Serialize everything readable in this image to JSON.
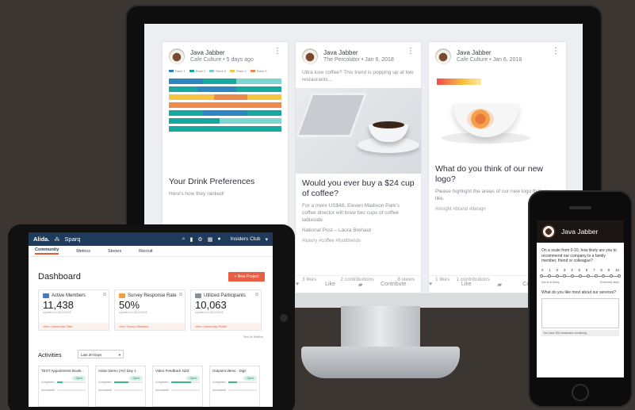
{
  "desktop": {
    "cards": [
      {
        "author": "Java Jabber",
        "meta": "Cafe Culture • 5 days ago",
        "chart_legend": [
          "Rank 1",
          "Rank 2",
          "Rank 3",
          "Rank 4",
          "Rank 5"
        ],
        "title": "Your Drink Preferences",
        "subtitle": "Here's how they ranked!"
      },
      {
        "author": "Java Jabber",
        "meta": "The Percolator • Jan 6, 2018",
        "teaser": "Ultra luxe coffee? This trend is popping up at two restaurants...",
        "title": "Would you ever buy a $24 cup of coffee?",
        "subtitle": "For a mere US$48, Eleven Madison Park's coffee director will brew two cups of coffee tableside",
        "source": "National Post – Laura Brehaut",
        "tags": "#luxury  #coffee  #foodtrends",
        "likes": "3 likes",
        "contributions": "2 contributions",
        "views": "8 views",
        "like_label": "Like",
        "contribute_label": "Contribute"
      },
      {
        "author": "Java Jabber",
        "meta": "Cafe Culture • Jan 6, 2018",
        "title": "What do you think of our new logo?",
        "subtitle": "Please highlight the areas of our new logo that you like.",
        "tags": "#insight  #brand  #design",
        "likes": "1 likes",
        "contributions": "1 contributions",
        "like_label": "Like",
        "contribute_label": "Contribute"
      }
    ]
  },
  "tablet": {
    "brand": "Alida.",
    "app": "Sparq",
    "community": "Insiders Club",
    "nav": [
      "Community",
      "Metrics",
      "Stories",
      "Recruit"
    ],
    "title": "Dashboard",
    "new_project": "+ New Project",
    "kpis": [
      {
        "label": "Active Members",
        "value": "11,438",
        "updated": "updated on 16/11/2020",
        "link": "View Community Data"
      },
      {
        "label": "Survey Response Rate",
        "value": "50%",
        "updated": "updated on 16/11/2020",
        "link": "View Survey Statistics"
      },
      {
        "label": "Utilized Participants",
        "value": "10,063",
        "updated": "updated on 16/11/2020",
        "link": "View Community Profile"
      }
    ],
    "see_all": "See All Metrics",
    "activities_title": "Activities",
    "range": "Last 30 Days",
    "activities": [
      {
        "name": "TEST Appointment Booki...",
        "status": "Open",
        "completes": 0.2
      },
      {
        "name": "Aidan Demo (AV) Day 1",
        "status": "Open",
        "completes": 0.5
      },
      {
        "name": "Video Feedback NZZ",
        "status": "Open",
        "completes": 0.7
      },
      {
        "name": "Outpoint demo · Digs",
        "status": "Open",
        "completes": 0.3
      }
    ],
    "completes_label": "Completes",
    "incomplete_label": "Incomplete"
  },
  "phone": {
    "title": "Java Jabber",
    "question": "On a scale from 0-10, how likely are you to recommend our company to a family member, friend or colleague?",
    "scale": [
      "0",
      "1",
      "2",
      "3",
      "4",
      "5",
      "6",
      "7",
      "8",
      "9",
      "10"
    ],
    "low": "Not at all likely",
    "high": "Extremely likely",
    "question2": "What do you like most about our services?",
    "remaining": "You have 300 characters remaining"
  }
}
